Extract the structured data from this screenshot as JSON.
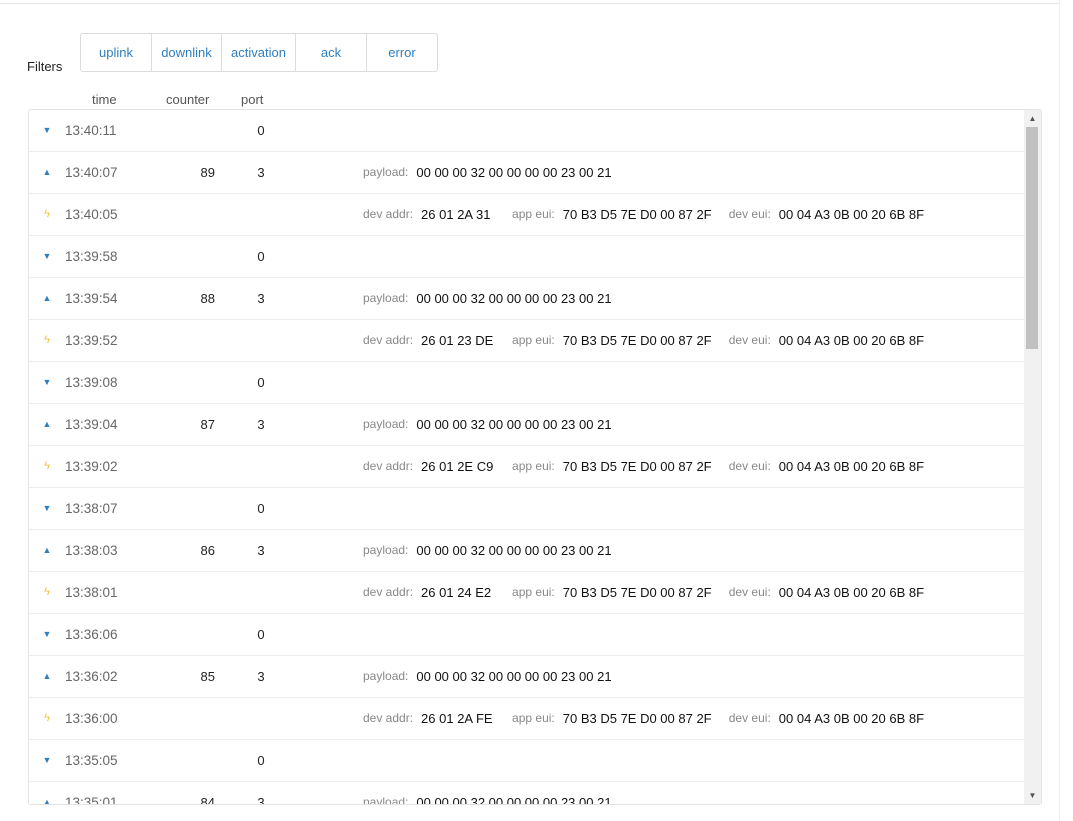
{
  "filters": {
    "label": "Filters",
    "buttons": [
      "uplink",
      "downlink",
      "activation",
      "ack",
      "error"
    ]
  },
  "columns": {
    "time": "time",
    "counter": "counter",
    "port": "port"
  },
  "field_labels": {
    "payload": "payload:",
    "dev_addr": "dev addr:",
    "app_eui": "app eui:",
    "dev_eui": "dev eui:"
  },
  "icons": {
    "downlink": "caret-down-icon",
    "uplink": "caret-up-icon",
    "activation": "lightning-icon"
  },
  "colors": {
    "accent": "#2f7fc1",
    "activation": "#f0c040"
  },
  "rows": [
    {
      "type": "downlink",
      "time": "13:40:11",
      "counter": "",
      "port": "0"
    },
    {
      "type": "uplink",
      "time": "13:40:07",
      "counter": "89",
      "port": "3",
      "payload": "00 00 00 32 00 00 00 00 23 00 21"
    },
    {
      "type": "activation",
      "time": "13:40:05",
      "dev_addr": "26 01 2A 31",
      "app_eui": "70 B3 D5 7E D0 00 87 2F",
      "dev_eui": "00 04 A3 0B 00 20 6B 8F"
    },
    {
      "type": "downlink",
      "time": "13:39:58",
      "counter": "",
      "port": "0"
    },
    {
      "type": "uplink",
      "time": "13:39:54",
      "counter": "88",
      "port": "3",
      "payload": "00 00 00 32 00 00 00 00 23 00 21"
    },
    {
      "type": "activation",
      "time": "13:39:52",
      "dev_addr": "26 01 23 DE",
      "app_eui": "70 B3 D5 7E D0 00 87 2F",
      "dev_eui": "00 04 A3 0B 00 20 6B 8F"
    },
    {
      "type": "downlink",
      "time": "13:39:08",
      "counter": "",
      "port": "0"
    },
    {
      "type": "uplink",
      "time": "13:39:04",
      "counter": "87",
      "port": "3",
      "payload": "00 00 00 32 00 00 00 00 23 00 21"
    },
    {
      "type": "activation",
      "time": "13:39:02",
      "dev_addr": "26 01 2E C9",
      "app_eui": "70 B3 D5 7E D0 00 87 2F",
      "dev_eui": "00 04 A3 0B 00 20 6B 8F"
    },
    {
      "type": "downlink",
      "time": "13:38:07",
      "counter": "",
      "port": "0"
    },
    {
      "type": "uplink",
      "time": "13:38:03",
      "counter": "86",
      "port": "3",
      "payload": "00 00 00 32 00 00 00 00 23 00 21"
    },
    {
      "type": "activation",
      "time": "13:38:01",
      "dev_addr": "26 01 24 E2",
      "app_eui": "70 B3 D5 7E D0 00 87 2F",
      "dev_eui": "00 04 A3 0B 00 20 6B 8F"
    },
    {
      "type": "downlink",
      "time": "13:36:06",
      "counter": "",
      "port": "0"
    },
    {
      "type": "uplink",
      "time": "13:36:02",
      "counter": "85",
      "port": "3",
      "payload": "00 00 00 32 00 00 00 00 23 00 21"
    },
    {
      "type": "activation",
      "time": "13:36:00",
      "dev_addr": "26 01 2A FE",
      "app_eui": "70 B3 D5 7E D0 00 87 2F",
      "dev_eui": "00 04 A3 0B 00 20 6B 8F"
    },
    {
      "type": "downlink",
      "time": "13:35:05",
      "counter": "",
      "port": "0"
    },
    {
      "type": "uplink",
      "time": "13:35:01",
      "counter": "84",
      "port": "3",
      "payload": "00 00 00 32 00 00 00 00 23 00 21"
    }
  ]
}
